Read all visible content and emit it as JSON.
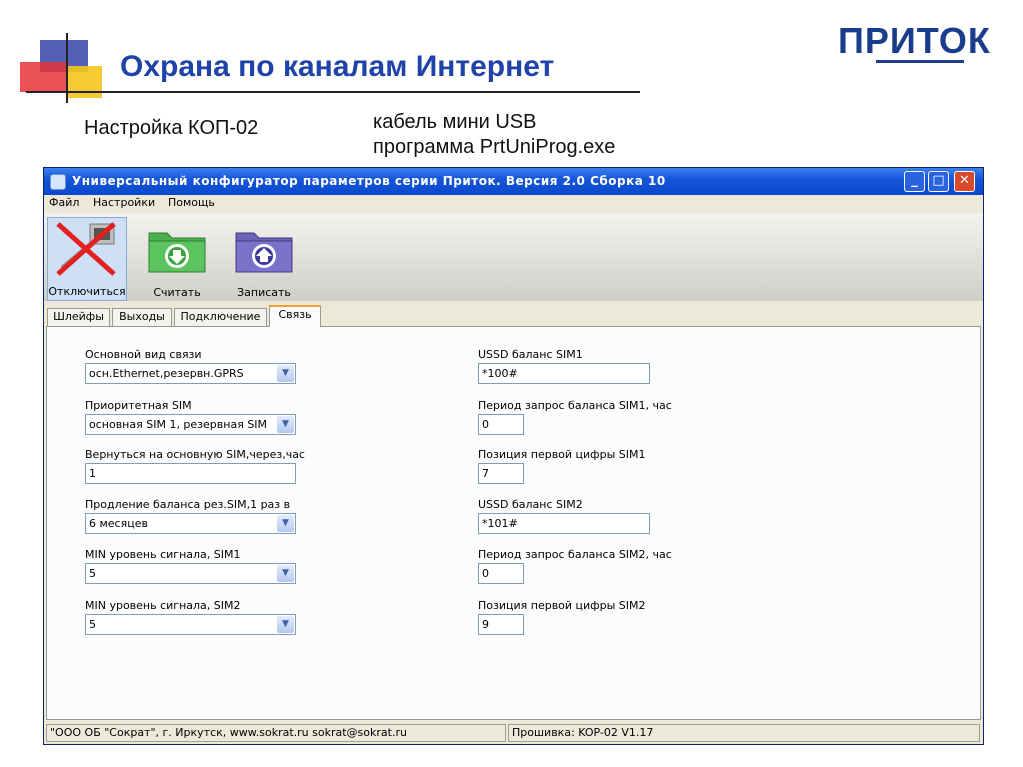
{
  "slide": {
    "title": "Охрана по каналам Интернет",
    "logo": "ПРИТОК",
    "subtitle_left": "Настройка КОП-02",
    "subtitle_right_line1": "кабель мини USB",
    "subtitle_right_line2": "программа  PrtUniProg.exe"
  },
  "window": {
    "title": "Универсальный конфигуратор параметров серии Приток. Версия 2.0 Сборка 10",
    "controls": {
      "minimize": "_",
      "maximize": "□",
      "close": "✕"
    }
  },
  "menu": [
    "Файл",
    "Настройки",
    "Помощь"
  ],
  "toolbar": {
    "disconnect": "Отключиться",
    "read": "Считать",
    "write": "Записать"
  },
  "tabs": [
    "Шлейфы",
    "Выходы",
    "Подключение",
    "Связь"
  ],
  "active_tab": "Связь",
  "form": {
    "left": [
      {
        "label": "Основной вид связи",
        "value": "осн.Ethernet,резервн.GPRS",
        "type": "select"
      },
      {
        "label": "Приоритетная SIM",
        "value": "основная SIM 1, резервная SIM",
        "type": "select"
      },
      {
        "label": "Вернуться на основную SIM,через,час",
        "value": "1",
        "type": "text"
      },
      {
        "label": "Продление баланса рез.SIM,1 раз в",
        "value": "6 месяцев",
        "type": "select"
      },
      {
        "label": "MIN уровень сигнала, SIM1",
        "value": "5",
        "type": "select"
      },
      {
        "label": "MIN уровень сигнала, SIM2",
        "value": "5",
        "type": "select"
      }
    ],
    "right": [
      {
        "label": "USSD баланс SIM1",
        "value": "*100#"
      },
      {
        "label": "Период запрос баланса SIM1, час",
        "value": "0"
      },
      {
        "label": "Позиция первой цифры SIM1",
        "value": "7"
      },
      {
        "label": "USSD баланс SIM2",
        "value": "*101#"
      },
      {
        "label": "Период запрос баланса SIM2, час",
        "value": "0"
      },
      {
        "label": "Позиция первой цифры SIM2",
        "value": "9"
      }
    ]
  },
  "status": {
    "company": "\"ООО ОБ \"Сократ\", г. Иркутск,    www.sokrat.ru   sokrat@sokrat.ru",
    "firmware": "Прошивка: KOP-02 V1.17"
  }
}
